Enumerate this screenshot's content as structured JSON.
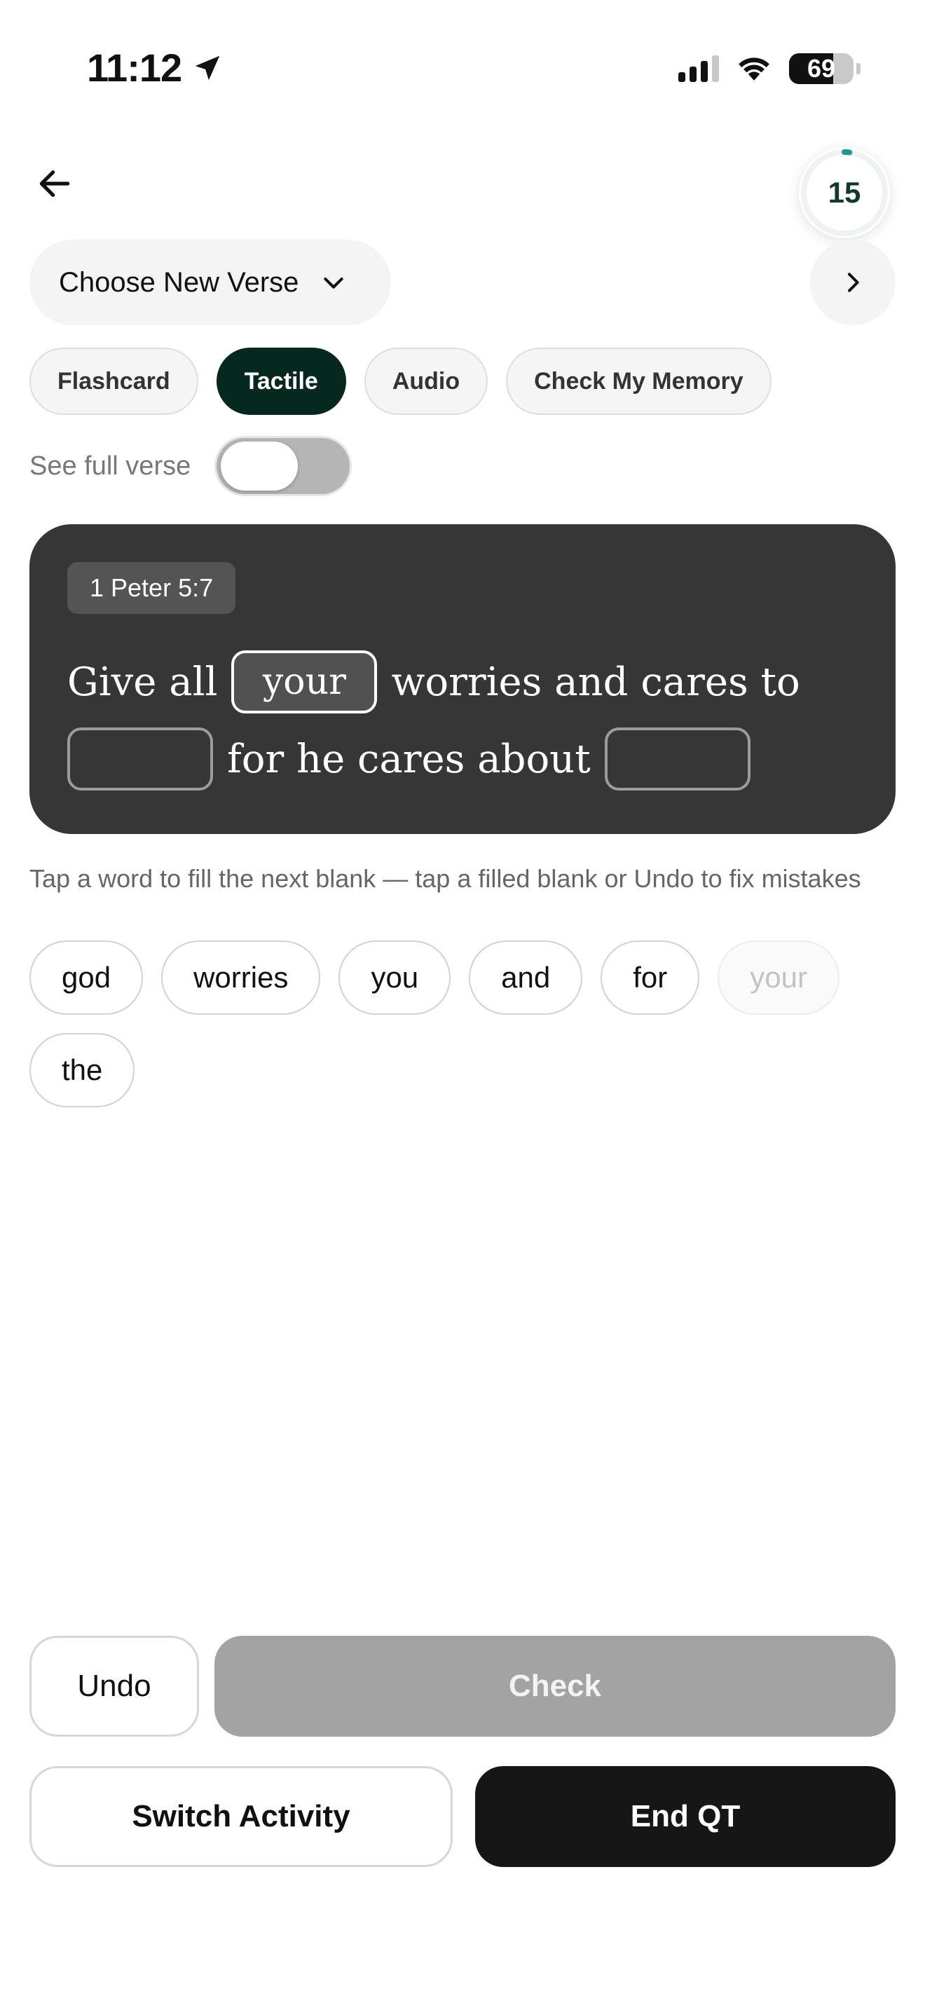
{
  "status_bar": {
    "time": "11:12",
    "battery_percent": "69",
    "battery_level": 0.69,
    "icons": [
      "location-arrow-icon",
      "cellular-signal-icon",
      "wifi-icon",
      "battery-icon"
    ]
  },
  "header": {
    "back_icon": "arrow-left-icon",
    "timer_value": "15",
    "timer_progress": 0.02,
    "timer_accent": "#1a9a8a",
    "verse_select_label": "Choose New Verse",
    "verse_select_icon": "chevron-down-icon",
    "next_icon": "chevron-right-icon"
  },
  "tabs": [
    {
      "label": "Flashcard",
      "active": false
    },
    {
      "label": "Tactile",
      "active": true
    },
    {
      "label": "Audio",
      "active": false
    },
    {
      "label": "Check My Memory",
      "active": false
    }
  ],
  "toggle": {
    "label": "See full verse",
    "on": false
  },
  "verse": {
    "reference": "1 Peter 5:7",
    "line1": {
      "before": "Give all",
      "blank_value": "your",
      "after": "worries and cares to"
    },
    "line2": {
      "blank1_value": "",
      "middle": "for he cares about",
      "blank2_value": ""
    }
  },
  "hint": "Tap a word to fill the next blank — tap a filled blank or Undo to fix mistakes",
  "word_bank": [
    {
      "word": "god",
      "used": false
    },
    {
      "word": "worries",
      "used": false
    },
    {
      "word": "you",
      "used": false
    },
    {
      "word": "and",
      "used": false
    },
    {
      "word": "for",
      "used": false
    },
    {
      "word": "your",
      "used": true
    },
    {
      "word": "the",
      "used": false
    }
  ],
  "actions": {
    "undo": "Undo",
    "check": "Check",
    "switch": "Switch Activity",
    "end": "End QT"
  },
  "colors": {
    "active_tab": "#06291f",
    "card_bg": "#363636",
    "check_disabled": "#a3a3a3",
    "end_button": "#161616"
  }
}
